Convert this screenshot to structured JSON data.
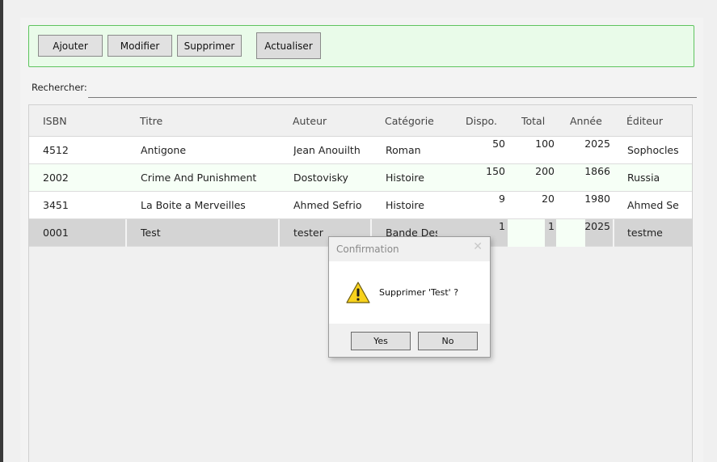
{
  "toolbar": {
    "add_label": "Ajouter",
    "edit_label": "Modifier",
    "delete_label": "Supprimer",
    "refresh_label": "Actualiser"
  },
  "search": {
    "label": "Rechercher:",
    "value": ""
  },
  "table": {
    "columns": [
      "ISBN",
      "Titre",
      "Auteur",
      "Catégorie",
      "Dispo.",
      "Total",
      "Année",
      "Éditeur"
    ],
    "rows": [
      [
        "4512",
        "Antigone",
        "Jean Anouilth",
        "Roman",
        "50",
        "100",
        "2025",
        "Sophocles"
      ],
      [
        "2002",
        "Crime And Punishment",
        "Dostovisky",
        "Histoire",
        "150",
        "200",
        "1866",
        "Russia"
      ],
      [
        "3451",
        "La Boite a Merveilles",
        "Ahmed Sefrio",
        "Histoire",
        "9",
        "20",
        "1980",
        "Ahmed Sefi"
      ],
      [
        "0001",
        "Test",
        "tester",
        "Bande Dess",
        "1",
        "1",
        "2025",
        "testme"
      ]
    ],
    "selected_row": 3
  },
  "dialog": {
    "title": "Confirmation",
    "message": "Supprimer 'Test' ?",
    "yes_label": "Yes",
    "no_label": "No",
    "icon": "warning-icon",
    "close_icon": "close-icon"
  },
  "colors": {
    "toolbar_bg": "#e9fbe9",
    "toolbar_border": "#5fc45f",
    "alt_row": "#f6fff6",
    "selected_row": "#d4d4d4"
  }
}
